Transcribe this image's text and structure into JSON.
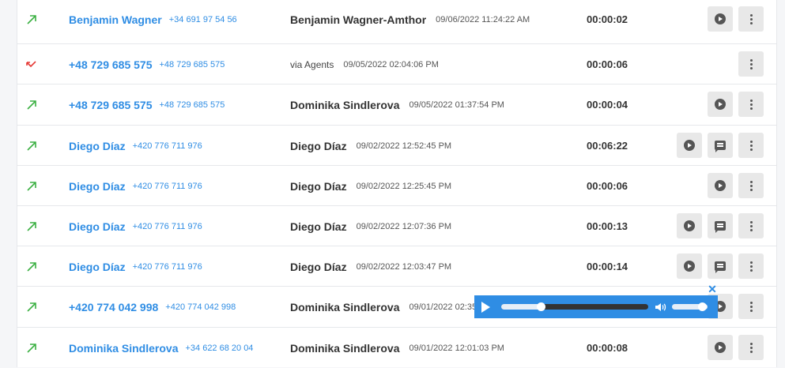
{
  "calls": [
    {
      "direction": "outgoing",
      "contact_name": "Benjamin Wagner",
      "contact_number": "+34 691 97 54 56",
      "agent": "Benjamin Wagner-Amthor",
      "agent_plain": false,
      "datetime": "09/06/2022 11:24:22 AM",
      "duration": "00:00:02",
      "has_play": true,
      "has_notes": false
    },
    {
      "direction": "missed",
      "contact_name": "+48 729 685 575",
      "contact_number": "+48 729 685 575",
      "agent": "via Agents",
      "agent_plain": true,
      "datetime": "09/05/2022 02:04:06 PM",
      "duration": "00:00:06",
      "has_play": false,
      "has_notes": false
    },
    {
      "direction": "outgoing",
      "contact_name": "+48 729 685 575",
      "contact_number": "+48 729 685 575",
      "agent": "Dominika Sindlerova",
      "agent_plain": false,
      "datetime": "09/05/2022 01:37:54 PM",
      "duration": "00:00:04",
      "has_play": true,
      "has_notes": false
    },
    {
      "direction": "outgoing",
      "contact_name": "Diego Díaz",
      "contact_number": "+420 776 711 976",
      "agent": "Diego Díaz",
      "agent_plain": false,
      "datetime": "09/02/2022 12:52:45 PM",
      "duration": "00:06:22",
      "has_play": true,
      "has_notes": true
    },
    {
      "direction": "outgoing",
      "contact_name": "Diego Díaz",
      "contact_number": "+420 776 711 976",
      "agent": "Diego Díaz",
      "agent_plain": false,
      "datetime": "09/02/2022 12:25:45 PM",
      "duration": "00:00:06",
      "has_play": true,
      "has_notes": false
    },
    {
      "direction": "outgoing",
      "contact_name": "Diego Díaz",
      "contact_number": "+420 776 711 976",
      "agent": "Diego Díaz",
      "agent_plain": false,
      "datetime": "09/02/2022 12:07:36 PM",
      "duration": "00:00:13",
      "has_play": true,
      "has_notes": true
    },
    {
      "direction": "outgoing",
      "contact_name": "Diego Díaz",
      "contact_number": "+420 776 711 976",
      "agent": "Diego Díaz",
      "agent_plain": false,
      "datetime": "09/02/2022 12:03:47 PM",
      "duration": "00:00:14",
      "has_play": true,
      "has_notes": true
    },
    {
      "direction": "outgoing",
      "contact_name": "+420 774 042 998",
      "contact_number": "+420 774 042 998",
      "agent": "Dominika Sindlerova",
      "agent_plain": false,
      "datetime": "09/01/2022 02:35",
      "duration": "",
      "has_play": true,
      "has_notes": false
    },
    {
      "direction": "outgoing",
      "contact_name": "Dominika Sindlerova",
      "contact_number": "+34 622 68 20 04",
      "agent": "Dominika Sindlerova",
      "agent_plain": false,
      "datetime": "09/01/2022 12:01:03 PM",
      "duration": "00:00:08",
      "has_play": true,
      "has_notes": false
    }
  ],
  "player": {
    "progress": 0.27,
    "volume": 0.85,
    "close_label": "✕"
  },
  "colors": {
    "accent": "#2f8de4",
    "outgoing": "#3cb043",
    "missed": "#e53935"
  },
  "icons": {
    "outgoing": "arrow-up-right-icon",
    "missed": "missed-call-icon",
    "play": "play-circle-icon",
    "notes": "notes-icon",
    "menu": "more-vert-icon"
  }
}
